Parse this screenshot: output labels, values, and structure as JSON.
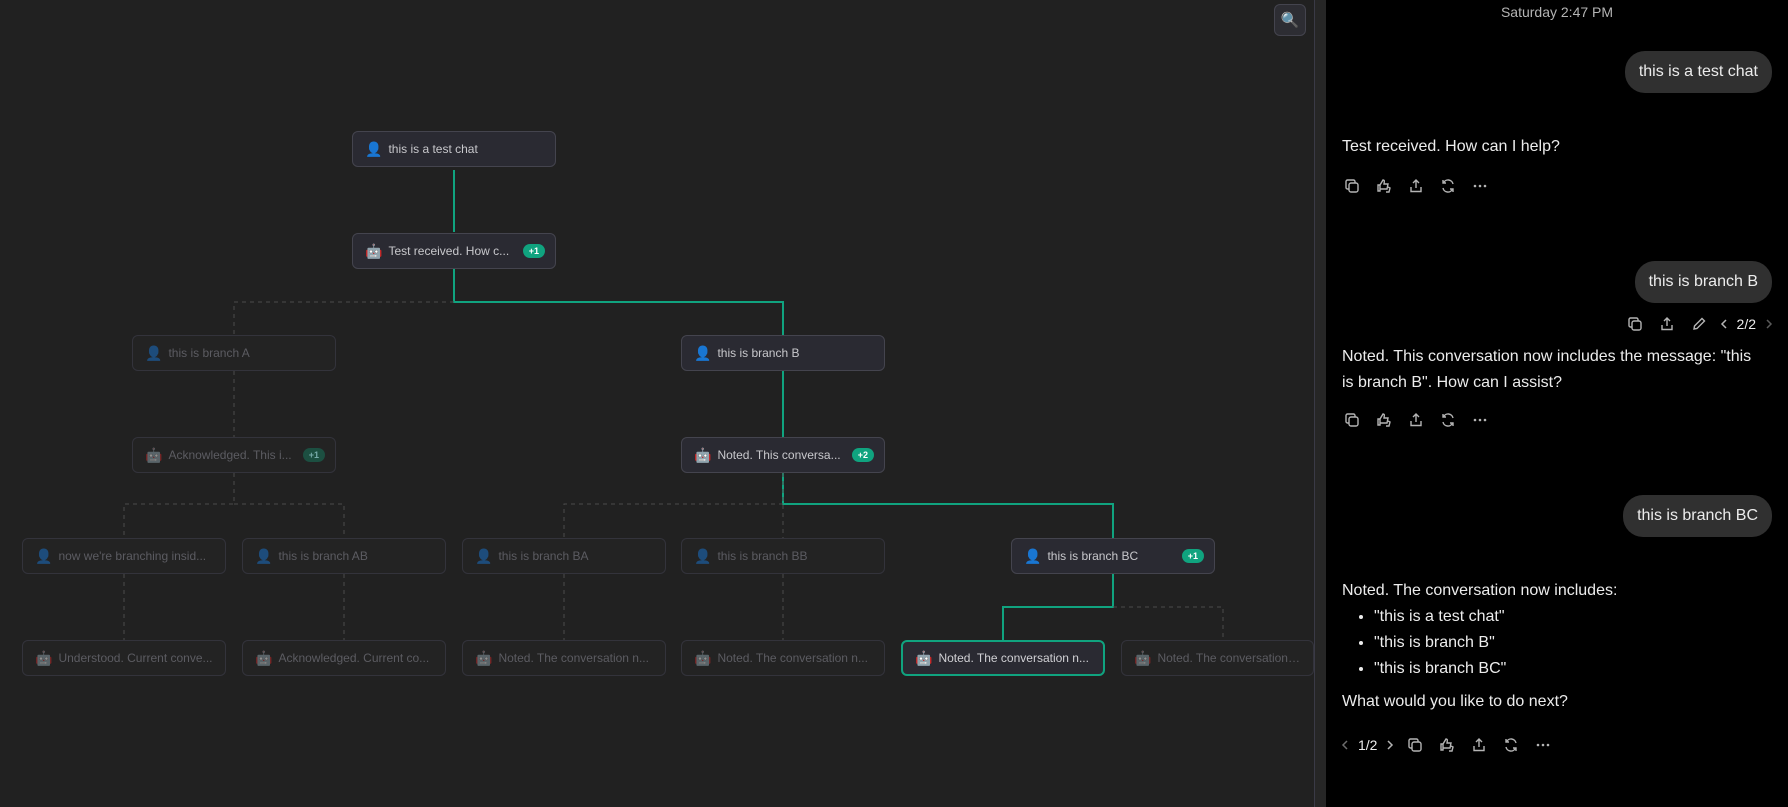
{
  "tree": {
    "nodes": [
      {
        "id": "root",
        "icon": "user-icon",
        "glyph": "👤",
        "text": "this is a test chat",
        "badge": "",
        "state": "normal"
      },
      {
        "id": "test-received",
        "icon": "robot-icon",
        "glyph": "🤖",
        "text": "Test received. How c...",
        "badge": "+1",
        "state": "normal"
      },
      {
        "id": "branch-a",
        "icon": "user-icon",
        "glyph": "👤",
        "text": "this is branch A",
        "badge": "",
        "state": "dim"
      },
      {
        "id": "branch-b",
        "icon": "user-icon",
        "glyph": "👤",
        "text": "this is branch B",
        "badge": "",
        "state": "normal"
      },
      {
        "id": "acknowledged",
        "icon": "robot-icon",
        "glyph": "🤖",
        "text": "Acknowledged. This i...",
        "badge": "+1",
        "state": "dim"
      },
      {
        "id": "noted-b",
        "icon": "robot-icon",
        "glyph": "🤖",
        "text": "Noted. This conversa...",
        "badge": "+2",
        "state": "normal"
      },
      {
        "id": "branch-inside",
        "icon": "user-icon",
        "glyph": "👤",
        "text": "now we're branching insid...",
        "badge": "",
        "state": "dim"
      },
      {
        "id": "branch-ab",
        "icon": "user-icon",
        "glyph": "👤",
        "text": "this is branch AB",
        "badge": "",
        "state": "dim"
      },
      {
        "id": "branch-ba",
        "icon": "user-icon",
        "glyph": "👤",
        "text": "this is branch BA",
        "badge": "",
        "state": "dim"
      },
      {
        "id": "branch-bb",
        "icon": "user-icon",
        "glyph": "👤",
        "text": "this is branch BB",
        "badge": "",
        "state": "dim"
      },
      {
        "id": "branch-bc",
        "icon": "user-icon",
        "glyph": "👤",
        "text": "this is branch BC",
        "badge": "+1",
        "state": "normal"
      },
      {
        "id": "understood",
        "icon": "robot-icon",
        "glyph": "🤖",
        "text": "Understood. Current conve...",
        "badge": "",
        "state": "dim"
      },
      {
        "id": "acknowledged-current",
        "icon": "robot-icon",
        "glyph": "🤖",
        "text": "Acknowledged. Current co...",
        "badge": "",
        "state": "dim"
      },
      {
        "id": "noted-ba",
        "icon": "robot-icon",
        "glyph": "🤖",
        "text": "Noted. The conversation n...",
        "badge": "",
        "state": "dim"
      },
      {
        "id": "noted-bb",
        "icon": "robot-icon",
        "glyph": "🤖",
        "text": "Noted. The conversation n...",
        "badge": "",
        "state": "dim"
      },
      {
        "id": "noted-bc",
        "icon": "robot-icon",
        "glyph": "🤖",
        "text": "Noted. The conversation n...",
        "badge": "",
        "state": "active"
      },
      {
        "id": "noted-bc-2",
        "icon": "robot-icon",
        "glyph": "🤖",
        "text": "Noted. The conversation h...",
        "badge": "",
        "state": "dim"
      }
    ],
    "search_icon": "search-icon",
    "search_glyph": "🔍",
    "edge_active_color": "#10a37f",
    "edge_dim_color": "#4a4a4a"
  },
  "chat": {
    "timestamp": "Saturday 2:47 PM",
    "messages": [
      {
        "role": "user",
        "text": "this is a test chat"
      },
      {
        "role": "assistant",
        "text": "Test received. How can I help?"
      },
      {
        "role": "user",
        "text": "this is branch B",
        "pager": "2/2"
      },
      {
        "role": "assistant",
        "text": "Noted. This conversation now includes the message: \"this is branch B\". How can I assist?"
      },
      {
        "role": "user",
        "text": "this is branch BC"
      },
      {
        "role": "assistant",
        "intro": "Noted. The conversation now includes:",
        "items": [
          "\"this is a test chat\"",
          "\"this is branch B\"",
          "\"this is branch BC\""
        ],
        "outro": "What would you like to do next?",
        "pager": "1/2"
      }
    ],
    "action_icons": [
      "copy-icon",
      "thumbs-icon",
      "share-icon",
      "regenerate-icon",
      "more-icon"
    ],
    "user_action_icons": [
      "copy-icon",
      "share-icon",
      "edit-icon"
    ]
  }
}
